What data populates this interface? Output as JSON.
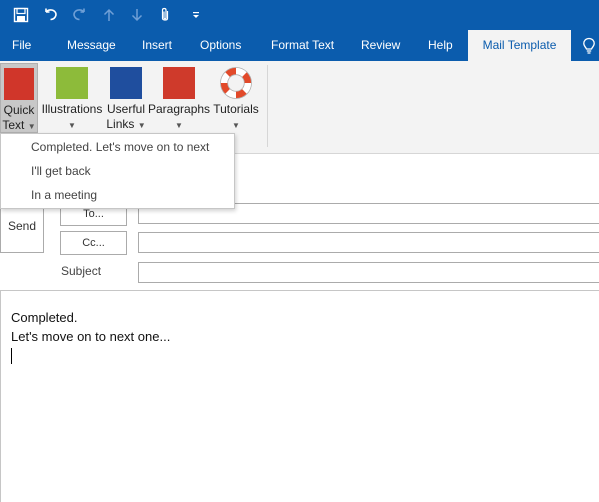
{
  "colors": {
    "accent": "#0b5cad",
    "ribbon_bg": "#f3f3f3",
    "quick_text": "#d0362a",
    "illustrations": "#8dbb3a",
    "links": "#1f4e9e",
    "paragraphs": "#cf3a2b"
  },
  "qat": [
    {
      "icon": "save-icon"
    },
    {
      "icon": "undo-icon"
    },
    {
      "icon": "redo-icon"
    },
    {
      "icon": "up-arrow-icon"
    },
    {
      "icon": "down-arrow-icon"
    },
    {
      "icon": "paperclip-icon"
    },
    {
      "icon": "customize-dropdown-icon"
    }
  ],
  "tabs": [
    "File",
    "Message",
    "Insert",
    "Options",
    "Format Text",
    "Review",
    "Help",
    "Mail Template"
  ],
  "active_tab": "Mail Template",
  "ribbon": {
    "quick_text": {
      "line1": "Quick",
      "line2": "Text"
    },
    "illustrations": {
      "line1": "Illustrations"
    },
    "links": {
      "line1": "Userful",
      "line2": "Links"
    },
    "paragraphs": {
      "line1": "Paragraphs"
    },
    "tutorials": {
      "line1": "Tutorials"
    }
  },
  "dropdown": {
    "items": [
      "Completed. Let's move on to next",
      "I'll get back",
      "In a meeting"
    ]
  },
  "compose": {
    "send": "Send",
    "to": "To...",
    "cc": "Cc...",
    "subject": "Subject",
    "to_value": "",
    "cc_value": "",
    "subject_value": ""
  },
  "body": {
    "line1": "Completed.",
    "line2": "Let's move on to next one..."
  }
}
